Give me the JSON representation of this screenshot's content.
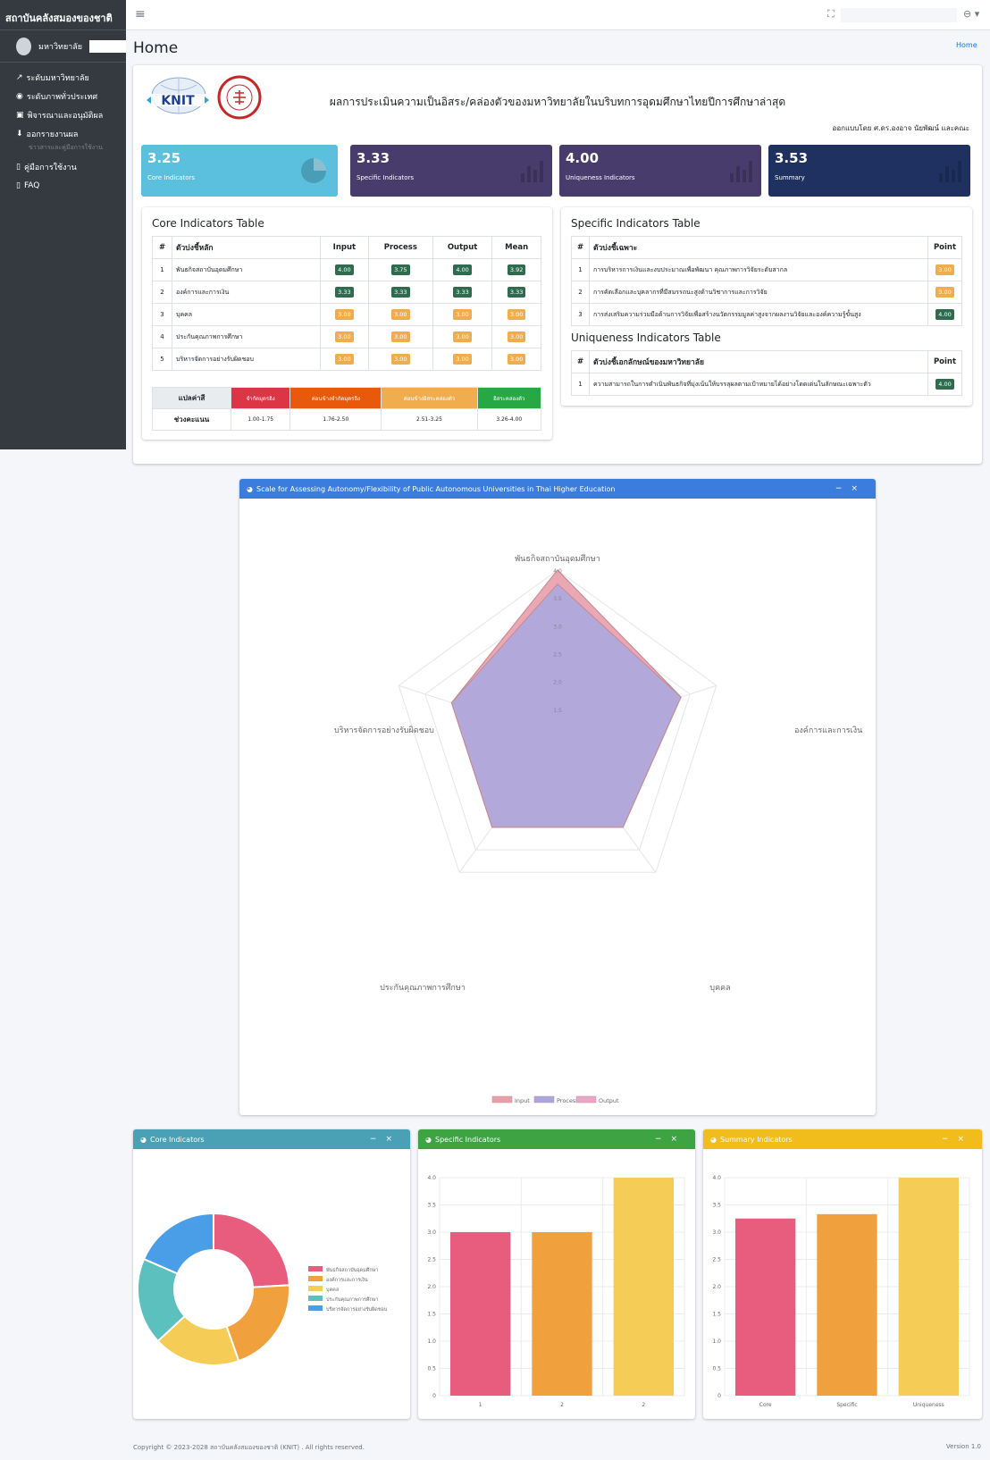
{
  "app": {
    "brand": "สถาบันคลังสมองของชาติ",
    "user_name": "มหาวิทยาลัย"
  },
  "sidebar": {
    "items": [
      {
        "icon": "chart-line-icon",
        "label": "ระดับมหาวิทยาลัย"
      },
      {
        "icon": "globe-icon",
        "label": "ระดับภาพทั่วประเทศ"
      },
      {
        "icon": "copy-icon",
        "label": "พิจารณาและอนุมัติผล"
      },
      {
        "icon": "download-icon",
        "label": "ออกรายงานผล"
      }
    ],
    "section_header": "ข่าวสารและคู่มือการใช้งาน",
    "items2": [
      {
        "icon": "file-icon",
        "label": "คู่มือการใช้งาน"
      },
      {
        "icon": "file-icon",
        "label": "FAQ"
      }
    ]
  },
  "topbar": {
    "menu_icon": "≡",
    "expand_icon": "⛶",
    "user_icon": "⊖ ▾"
  },
  "page": {
    "title": "Home",
    "breadcrumb": "Home"
  },
  "header": {
    "knit_text": "KNIT",
    "title": "ผลการประเมินความเป็นอิสระ/คล่องตัวของมหาวิทยาลัยในบริบทการอุดมศึกษาไทยปีการศึกษาล่าสุด",
    "subtitle": "ออกแบบโดย ศ.ดร.องอาจ นัยพัฒน์ และคณะ"
  },
  "summary_boxes": [
    {
      "value": "3.25",
      "label": "Core Indicators",
      "color": "#5bc0de"
    },
    {
      "value": "3.33",
      "label": "Specific Indicators",
      "color": "#483c6c"
    },
    {
      "value": "4.00",
      "label": "Uniqueness Indicators",
      "color": "#483c6c"
    },
    {
      "value": "3.53",
      "label": "Summary",
      "color": "#1e3160"
    }
  ],
  "core_table": {
    "title": "Core Indicators Table",
    "headers": [
      "#",
      "ตัวบ่งชี้หลัก",
      "Input",
      "Process",
      "Output",
      "Mean"
    ],
    "rows": [
      {
        "n": "1",
        "name": "พันธกิจสถาบันอุดมศึกษา",
        "input": "4.00",
        "process": "3.75",
        "output": "4.00",
        "mean": "3.92"
      },
      {
        "n": "2",
        "name": "องค์การและการเงิน",
        "input": "3.33",
        "process": "3.33",
        "output": "3.33",
        "mean": "3.33"
      },
      {
        "n": "3",
        "name": "บุคคล",
        "input": "3.00",
        "process": "3.00",
        "output": "3.00",
        "mean": "3.00"
      },
      {
        "n": "4",
        "name": "ประกันคุณภาพการศึกษา",
        "input": "3.00",
        "process": "3.00",
        "output": "3.00",
        "mean": "3.00"
      },
      {
        "n": "5",
        "name": "บริหารจัดการอย่างรับผิดชอบ",
        "input": "3.00",
        "process": "3.00",
        "output": "3.00",
        "mean": "3.00"
      }
    ]
  },
  "legend_table": {
    "label1": "แปลค่าสี",
    "label2": "ช่วงคะแนน",
    "cats": [
      "จำกัดมุดรอิง",
      "ค่อนข้างจำกัดมุดรอิง",
      "ค่อนข้างอิสระคล่องตัว",
      "อิสระคล่องตัว"
    ],
    "ranges": [
      "1.00-1.75",
      "1.76-2.50",
      "2.51-3.25",
      "3.26-4.00"
    ],
    "colors": [
      "#dc3545",
      "#e8590c",
      "#f0ad4e",
      "#28a745"
    ]
  },
  "specific_table": {
    "title": "Specific Indicators Table",
    "headers": [
      "#",
      "ตัวบ่งชี้เฉพาะ",
      "Point"
    ],
    "rows": [
      {
        "n": "1",
        "name": "การบริหารการเงินและงบประมาณเพื่อพัฒนา คุณภาพการวิจัยระดับสากล",
        "point": "3.00"
      },
      {
        "n": "2",
        "name": "การคัดเลือกและบุคลากรที่มีสมรรถนะสูงด้านวิชาการและการวิจัย",
        "point": "3.00"
      },
      {
        "n": "3",
        "name": "การส่งเสริมความร่วมมือด้านการวิจัยเพื่อสร้างนวัตกรรมมูลค่าสูงจากผลงานวิจัยและองค์ความรู้ขั้นสูง",
        "point": "4.00"
      }
    ]
  },
  "uniqueness_table": {
    "title": "Uniqueness Indicators Table",
    "headers": [
      "#",
      "ตัวบ่งชี้เอกลักษณ์ของมหาวิทยาลัย",
      "Point"
    ],
    "rows": [
      {
        "n": "1",
        "name": "ความสามารถในการดำเนินพันธกิจที่มุ่งเน้นให้บรรลุผลตามเป้าหมายได้อย่างโดดเด่นในลักษณะเฉพาะตัว",
        "point": "4.00"
      }
    ]
  },
  "colors": {
    "badge_green": "#2f6b4f",
    "badge_yellow": "#f0ad4e",
    "radar_header": "#3b7ddd",
    "core_header": "#4aa0b5",
    "specific_header": "#3da343",
    "summary_header": "#f0bd1c"
  },
  "radar": {
    "header": "Scale for Assessing Autonomy/Flexibility of Public Autonomous Universities in Thai Higher Education",
    "axes": [
      "พันธกิจสถาบันอุดมศึกษา",
      "องค์การและการเงิน",
      "บุคคล",
      "ประกันคุณภาพการศึกษา",
      "บริหารจัดการอย่างรับผิดชอบ"
    ],
    "ticks": [
      "4.0",
      "3.5",
      "3.0",
      "2.5",
      "2.0",
      "1.5"
    ],
    "legend": [
      "Input",
      "Process",
      "Output"
    ]
  },
  "core_card": {
    "header": "Core Indicators"
  },
  "specific_card": {
    "header": "Specific Indicators"
  },
  "summary_card": {
    "header": "Summary Indicators"
  },
  "footer": {
    "text": "Copyright © 2023-2028 สถาบันคลังสมองของชาติ (KNIT) . All rights reserved.",
    "version": "Version 1.0"
  },
  "chart_data": [
    {
      "type": "radar",
      "categories": [
        "พันธกิจสถาบันอุดมศึกษา",
        "องค์การและการเงิน",
        "บุคคล",
        "ประกันคุณภาพการศึกษา",
        "บริหารจัดการอย่างรับผิดชอบ"
      ],
      "series": [
        {
          "name": "Input",
          "values": [
            4.0,
            3.33,
            3.0,
            3.0,
            3.0
          ],
          "color": "#e8a0a8"
        },
        {
          "name": "Process",
          "values": [
            3.75,
            3.33,
            3.0,
            3.0,
            3.0
          ],
          "color": "#a8a8e0"
        },
        {
          "name": "Output",
          "values": [
            4.0,
            3.33,
            3.0,
            3.0,
            3.0
          ],
          "color": "#e8a8c8"
        }
      ],
      "rlim": [
        1,
        4
      ]
    },
    {
      "type": "pie",
      "categories": [
        "พันธกิจสถาบันอุดมศึกษา",
        "องค์การและการเงิน",
        "บุคคล",
        "ประกันคุณภาพการศึกษา",
        "บริหารจัดการอย่างรับผิดชอบ"
      ],
      "values": [
        3.92,
        3.33,
        3.0,
        3.0,
        3.0
      ],
      "colors": [
        "#e85c7e",
        "#f0a03c",
        "#f5cc55",
        "#5bc0be",
        "#4a9ee8"
      ]
    },
    {
      "type": "bar",
      "categories": [
        "1",
        "2",
        "2"
      ],
      "values": [
        3.0,
        3.0,
        4.0
      ],
      "colors": [
        "#e85c7e",
        "#f0a03c",
        "#f5cc55"
      ],
      "ylim": [
        0,
        4
      ],
      "yticks": [
        "4.0",
        "3.5",
        "3.0",
        "2.5",
        "2.0",
        "1.5",
        "1.0",
        "0.5",
        "0"
      ]
    },
    {
      "type": "bar",
      "categories": [
        "Core",
        "Specific",
        "Uniqueness"
      ],
      "values": [
        3.25,
        3.33,
        4.0
      ],
      "colors": [
        "#e85c7e",
        "#f0a03c",
        "#f5cc55"
      ],
      "ylim": [
        0,
        4
      ],
      "yticks": [
        "4.0",
        "3.5",
        "3.0",
        "2.5",
        "2.0",
        "1.5",
        "1.0",
        "0.5",
        "0"
      ]
    }
  ]
}
